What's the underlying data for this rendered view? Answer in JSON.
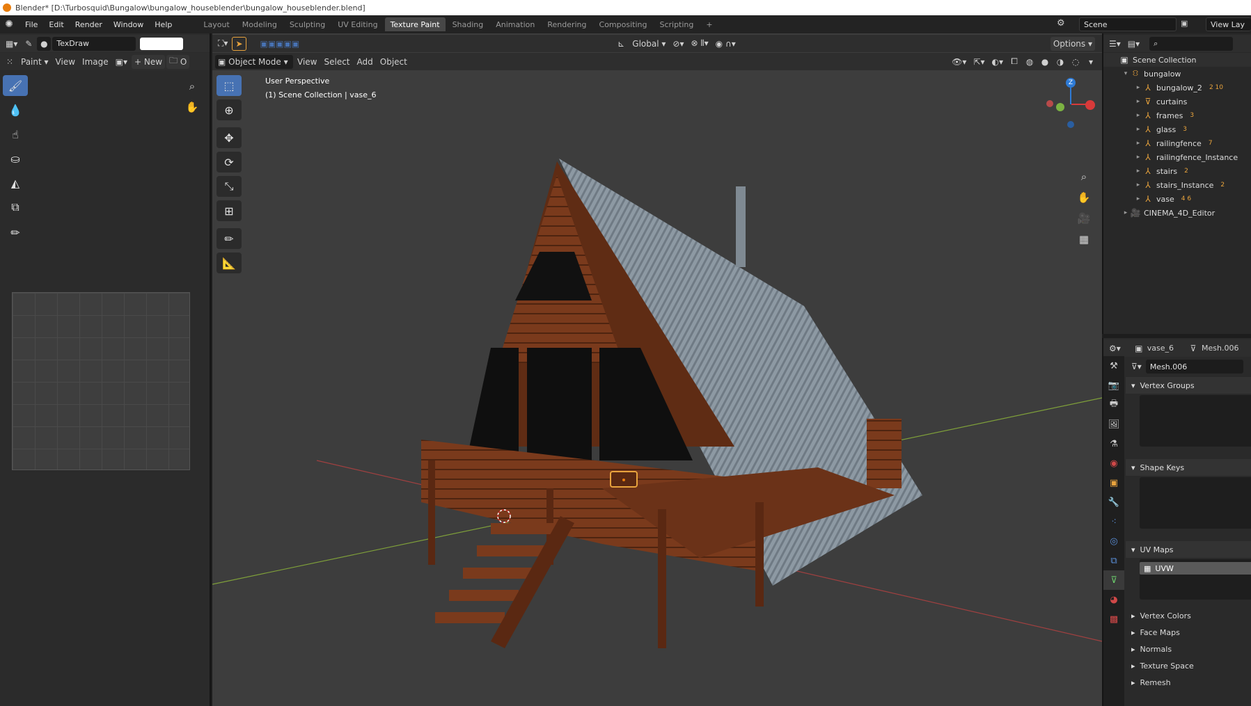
{
  "window": {
    "title": "Blender* [D:\\Turbosquid\\Bungalow\\bungalow_houseblender\\bungalow_houseblender.blend]"
  },
  "menu": [
    "File",
    "Edit",
    "Render",
    "Window",
    "Help"
  ],
  "workspaces": [
    "Layout",
    "Modeling",
    "Sculpting",
    "UV Editing",
    "Texture Paint",
    "Shading",
    "Animation",
    "Rendering",
    "Compositing",
    "Scripting"
  ],
  "active_workspace": "Texture Paint",
  "scene": {
    "name": "Scene",
    "view_layer": "View Lay"
  },
  "image_editor": {
    "brush_name": "TexDraw",
    "mode_label": "Paint",
    "menus": [
      "View",
      "Image"
    ],
    "new_label": "New",
    "open_label": "O"
  },
  "viewport": {
    "mode": "Object Mode",
    "menus": [
      "View",
      "Select",
      "Add",
      "Object"
    ],
    "transform_orientation": "Global",
    "options_label": "Options",
    "perspective_label": "User Perspective",
    "collection_label": "(1) Scene Collection | vase_6",
    "gizmo_z": "Z"
  },
  "outliner": {
    "root": "Scene Collection",
    "items": [
      {
        "name": "bungalow",
        "level": 1,
        "icon": "collection-icon"
      },
      {
        "name": "bungalow_2",
        "level": 2,
        "icon": "empty-icon",
        "badge": "2 10"
      },
      {
        "name": "curtains",
        "level": 2,
        "icon": "mesh-icon",
        "badge": ""
      },
      {
        "name": "frames",
        "level": 2,
        "icon": "empty-icon",
        "badge": "3"
      },
      {
        "name": "glass",
        "level": 2,
        "icon": "empty-icon",
        "badge": "3"
      },
      {
        "name": "railingfence",
        "level": 2,
        "icon": "empty-icon",
        "badge": "7"
      },
      {
        "name": "railingfence_Instance",
        "level": 2,
        "icon": "empty-icon",
        "badge": ""
      },
      {
        "name": "stairs",
        "level": 2,
        "icon": "empty-icon",
        "badge": "2"
      },
      {
        "name": "stairs_Instance",
        "level": 2,
        "icon": "empty-icon",
        "badge": "2"
      },
      {
        "name": "vase",
        "level": 2,
        "icon": "empty-icon",
        "badge": "4 6"
      },
      {
        "name": "CINEMA_4D_Editor",
        "level": 1,
        "icon": "camera-icon",
        "badge": ""
      }
    ]
  },
  "properties": {
    "object": "vase_6",
    "mesh": "Mesh.006",
    "mesh_field": "Mesh.006",
    "panels": [
      "Vertex Groups",
      "Shape Keys",
      "UV Maps"
    ],
    "uv_map": "UVW",
    "collapsed_panels": [
      "Vertex Colors",
      "Face Maps",
      "Normals",
      "Texture Space",
      "Remesh"
    ]
  },
  "colors": {
    "accent": "#4772b3",
    "roof": "#8a96a0",
    "wood": "#7a3a1c",
    "origin": "#e87d0d"
  }
}
